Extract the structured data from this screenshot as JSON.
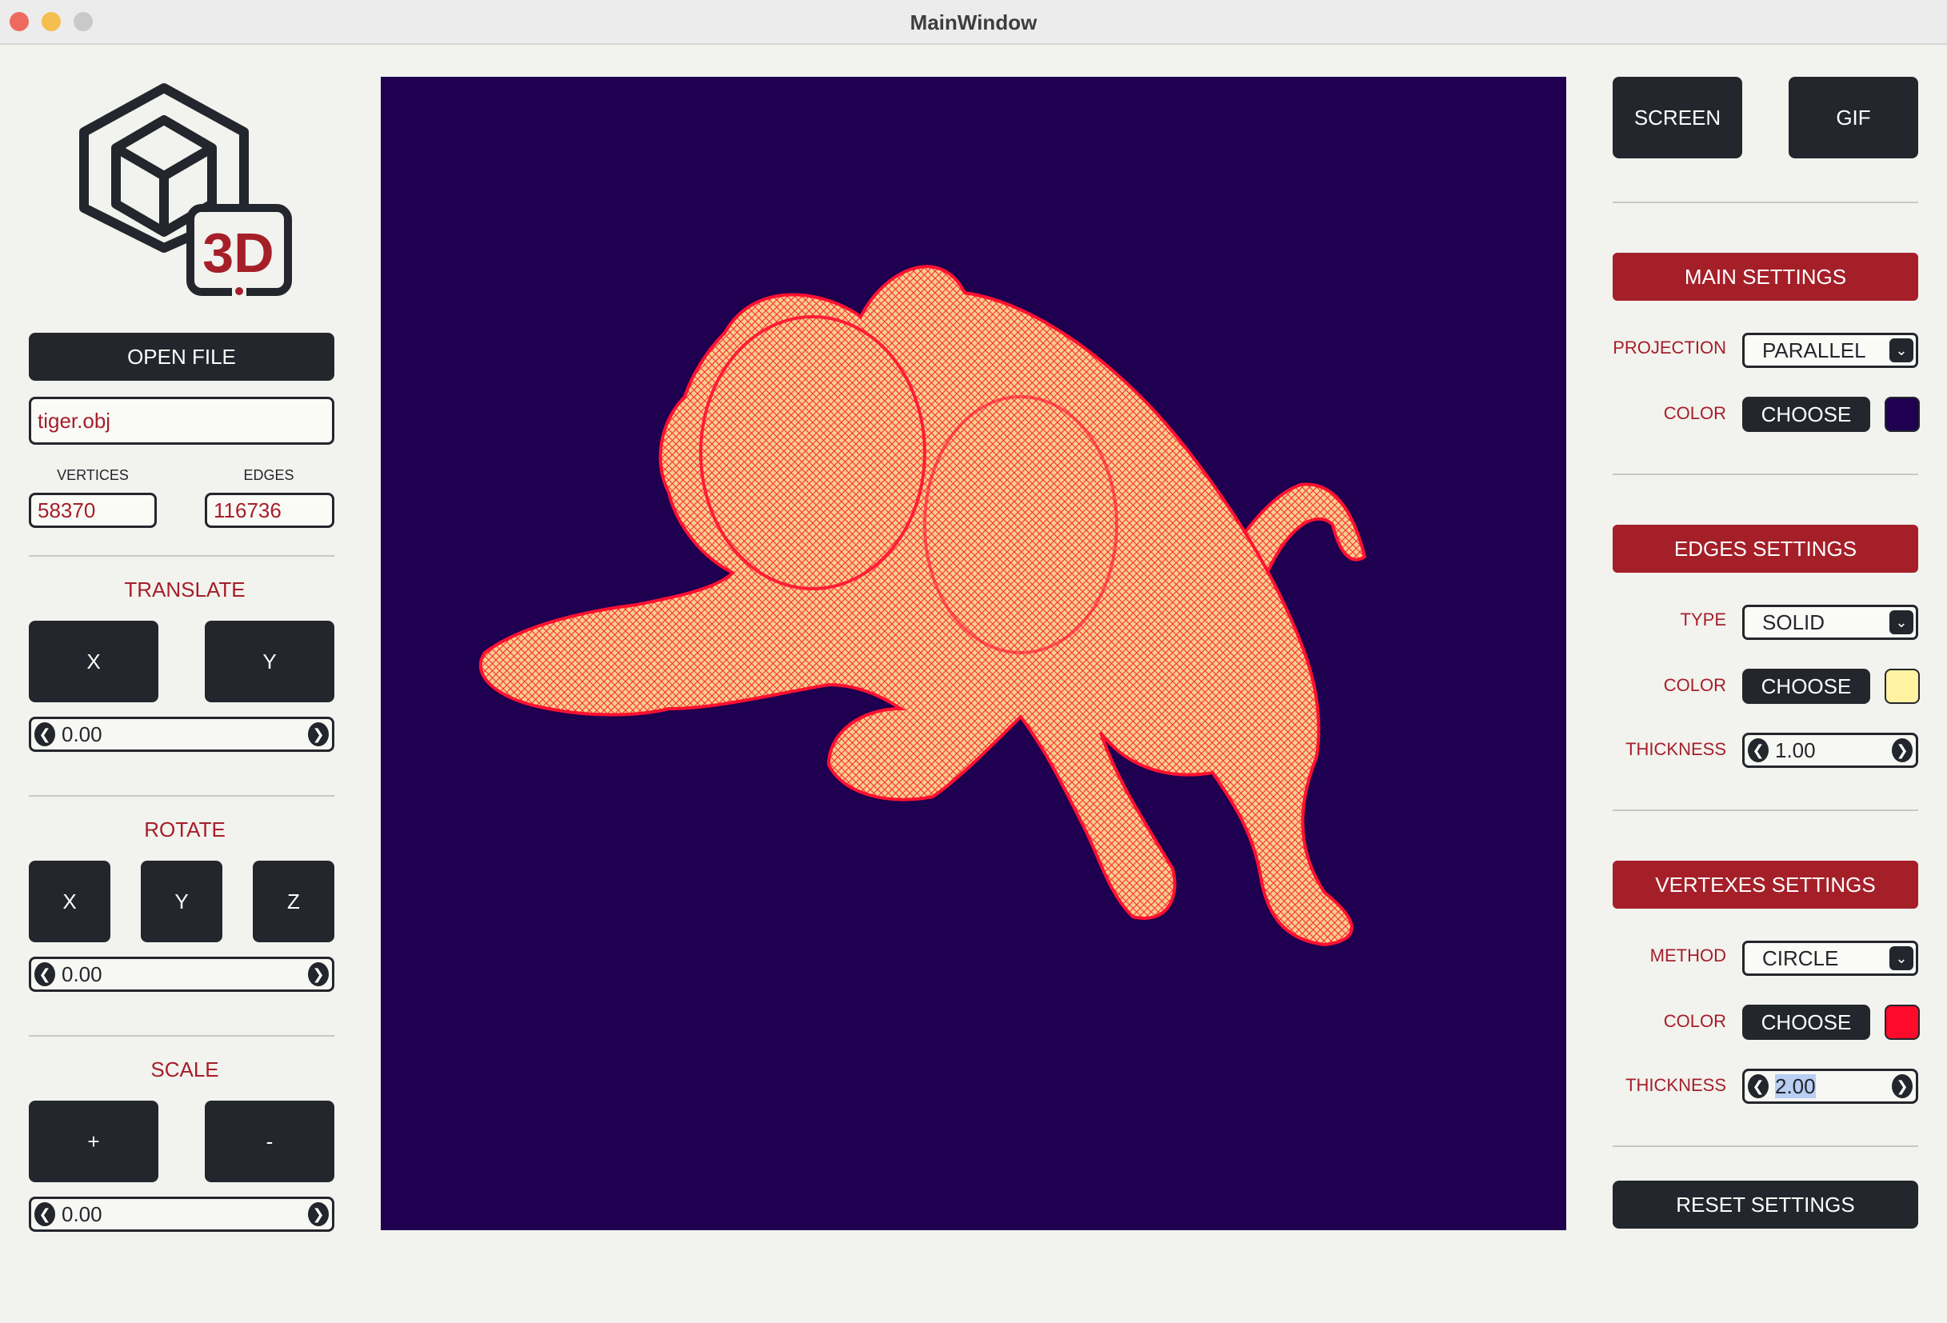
{
  "window": {
    "title": "MainWindow"
  },
  "logo": {
    "text": "3D"
  },
  "file": {
    "open_label": "OPEN FILE",
    "filename": "tiger.obj",
    "vertices_label": "VERTICES",
    "vertices_value": "58370",
    "edges_label": "EDGES",
    "edges_value": "116736"
  },
  "translate": {
    "title": "TRANSLATE",
    "x_label": "X",
    "y_label": "Y",
    "value": "0.00"
  },
  "rotate": {
    "title": "ROTATE",
    "x_label": "X",
    "y_label": "Y",
    "z_label": "Z",
    "value": "0.00"
  },
  "scale": {
    "title": "SCALE",
    "plus_label": "+",
    "minus_label": "-",
    "value": "0.00"
  },
  "capture": {
    "screen_label": "SCREEN",
    "gif_label": "GIF"
  },
  "main_settings": {
    "header": "MAIN SETTINGS",
    "projection_label": "PROJECTION",
    "projection_value": "PARALLEL",
    "color_label": "COLOR",
    "choose_label": "CHOOSE",
    "color_value": "#1f0050"
  },
  "edges_settings": {
    "header": "EDGES SETTINGS",
    "type_label": "TYPE",
    "type_value": "SOLID",
    "color_label": "COLOR",
    "choose_label": "CHOOSE",
    "color_value": "#fff2a0",
    "thickness_label": "THICKNESS",
    "thickness_value": "1.00"
  },
  "vertexes_settings": {
    "header": "VERTEXES SETTINGS",
    "method_label": "METHOD",
    "method_value": "CIRCLE",
    "color_label": "COLOR",
    "choose_label": "CHOOSE",
    "color_value": "#ff0a2a",
    "thickness_label": "THICKNESS",
    "thickness_value": "2.00"
  },
  "reset_label": "RESET SETTINGS",
  "colors": {
    "accent": "#a51f29",
    "dark": "#23262c",
    "background": "#f2f2ee",
    "viewport_bg": "#1f0050"
  },
  "icons": {
    "cube": "cube-logo-icon",
    "left": "chevron-left-icon",
    "right": "chevron-right-icon",
    "down": "chevron-down-icon"
  }
}
